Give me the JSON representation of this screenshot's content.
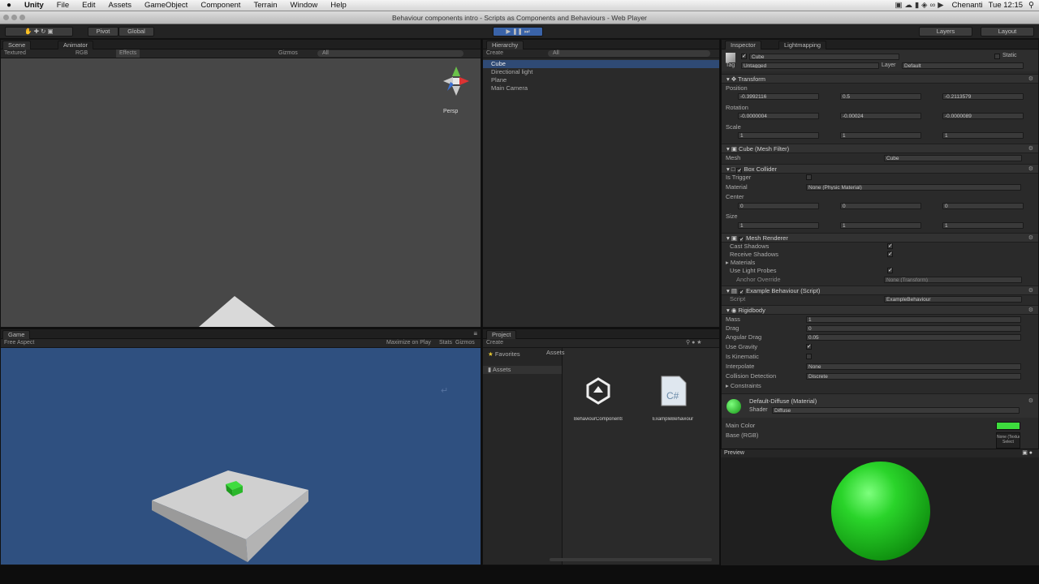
{
  "menubar": {
    "apple": "",
    "items": [
      "Unity",
      "File",
      "Edit",
      "Assets",
      "GameObject",
      "Component",
      "Terrain",
      "Window",
      "Help"
    ],
    "status": {
      "user": "Chenanti",
      "clock": "Tue 12:15"
    }
  },
  "window": {
    "title": "Behaviour components intro - Scripts as Components and Behaviours - Web Player"
  },
  "toolbar": {
    "pivot": "Pivot",
    "global": "Global",
    "layers": "Layers",
    "layout": "Layout"
  },
  "scene": {
    "tabs": [
      "Scene",
      "Animator"
    ],
    "mode": "Textured",
    "rgb": "RGB",
    "effects": "Effects",
    "gizmos": "Gizmos",
    "search": "All",
    "persp": "Persp"
  },
  "game": {
    "tab": "Game",
    "aspect": "Free Aspect",
    "maximize": "Maximize on Play",
    "stats": "Stats",
    "gizmos": "Gizmos"
  },
  "hierarchy": {
    "tab": "Hierarchy",
    "create": "Create",
    "search": "All",
    "items": [
      "Cube",
      "Directional light",
      "Plane",
      "Main Camera"
    ]
  },
  "project": {
    "tab": "Project",
    "create": "Create",
    "favorites": "Favorites",
    "assets_crumb": "Assets",
    "assets_folder": "Assets",
    "files": [
      {
        "icon": "unity-scene-icon",
        "name": "BehaviourComponents"
      },
      {
        "icon": "script-file-icon",
        "name": "ExampleBehaviour"
      }
    ]
  },
  "inspector": {
    "tabs": [
      "Inspector",
      "Lightmapping"
    ],
    "object": {
      "name": "Cube",
      "static": "Static",
      "tag_label": "Tag",
      "tag": "Untagged",
      "layer_label": "Layer",
      "layer": "Default"
    },
    "transform": {
      "name": "Transform",
      "position": {
        "label": "Position",
        "x": "-0.3992116",
        "y": "0.5",
        "z": "-0.2113579"
      },
      "rotation": {
        "label": "Rotation",
        "x": "-0.0000004",
        "y": "-0.00024",
        "z": "-0.0000089"
      },
      "scale": {
        "label": "Scale",
        "x": "1",
        "y": "1",
        "z": "1"
      }
    },
    "meshfilter": {
      "name": "Cube (Mesh Filter)",
      "mesh_label": "Mesh",
      "mesh": "Cube"
    },
    "boxcollider": {
      "name": "Box Collider",
      "trigger_label": "Is Trigger",
      "material_label": "Material",
      "material": "None (Physic Material)",
      "center_label": "Center",
      "size_label": "Size",
      "center": {
        "x": "0",
        "y": "0",
        "z": "0"
      },
      "size": {
        "x": "1",
        "y": "1",
        "z": "1"
      }
    },
    "meshrenderer": {
      "name": "Mesh Renderer",
      "cast": "Cast Shadows",
      "receive": "Receive Shadows",
      "materials": "Materials",
      "lightprobes": "Use Light Probes",
      "anchor_label": "Anchor Override",
      "anchor": "None (Transform)"
    },
    "script": {
      "name": "Example Behaviour (Script)",
      "label": "Script",
      "value": "ExampleBehaviour"
    },
    "rigidbody": {
      "name": "Rigidbody",
      "mass": "Mass",
      "mass_v": "1",
      "drag": "Drag",
      "drag_v": "0",
      "angular": "Angular Drag",
      "angular_v": "0.05",
      "gravity": "Use Gravity",
      "kinematic": "Is Kinematic",
      "interpolate": "Interpolate",
      "interpolate_v": "None",
      "collision": "Collision Detection",
      "collision_v": "Discrete",
      "constraints": "Constraints"
    },
    "material": {
      "name": "Default-Diffuse (Material)",
      "shader_label": "Shader",
      "shader": "Diffuse",
      "main_color": "Main Color",
      "base": "Base (RGB)",
      "none": "None (Texture)",
      "select": "Select",
      "swatch": "#3ddc3d"
    },
    "preview": {
      "label": "Preview",
      "sphere_color": "#22c322"
    }
  },
  "colors": {
    "game_bg": "#2f5080",
    "scene_bg": "#474747",
    "selected": "#3d6fb6"
  }
}
